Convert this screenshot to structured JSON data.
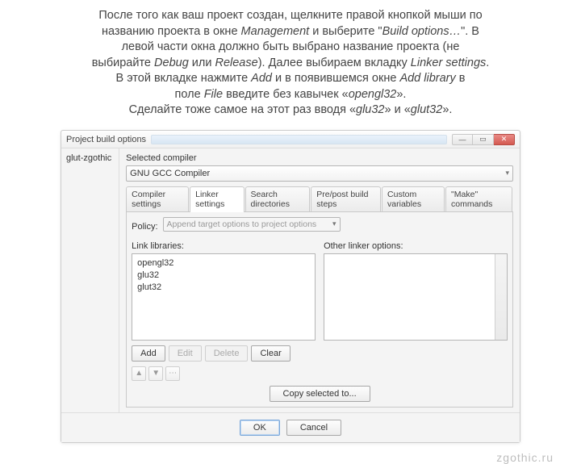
{
  "instructions": {
    "line1a": "После того как ваш проект создан, щелкните правой кнопкой мыши по",
    "line2a": "названию проекта в окне ",
    "line2b": "Management",
    "line2c": " и выберите \"",
    "line2d": "Build options…",
    "line2e": "\". В",
    "line3": "левой части окна должно быть выбрано название проекта (не",
    "line4a": "выбирайте ",
    "line4b": "Debug",
    "line4c": " или ",
    "line4d": "Release",
    "line4e": "). Далее выбираем вкладку ",
    "line4f": "Linker settings",
    "line4g": ".",
    "line5a": "В этой вкладке нажмите ",
    "line5b": "Add",
    "line5c": " и в появившемся окне ",
    "line5d": "Add library",
    "line5e": " в",
    "line6a": "поле ",
    "line6b": "File",
    "line6c": " введите без кавычек «",
    "line6d": "opengl32",
    "line6e": "».",
    "line7a": "Сделайте тоже самое на этот раз вводя «",
    "line7b": "glu32",
    "line7c": "» и «",
    "line7d": "glut32",
    "line7e": "»."
  },
  "dialog": {
    "title": "Project build options",
    "project_name": "glut-zgothic",
    "compiler_label": "Selected compiler",
    "compiler_value": "GNU GCC Compiler",
    "tabs": [
      "Compiler settings",
      "Linker settings",
      "Search directories",
      "Pre/post build steps",
      "Custom variables",
      "\"Make\" commands"
    ],
    "active_tab_index": 1,
    "policy_label": "Policy:",
    "policy_value": "Append target options to project options",
    "link_libs_label": "Link libraries:",
    "link_libs": [
      "opengl32",
      "glu32",
      "glut32"
    ],
    "other_opts_label": "Other linker options:",
    "buttons": {
      "add": "Add",
      "edit": "Edit",
      "delete": "Delete",
      "clear": "Clear",
      "copy": "Copy selected to...",
      "ok": "OK",
      "cancel": "Cancel"
    }
  },
  "brand": "zgothic.ru"
}
